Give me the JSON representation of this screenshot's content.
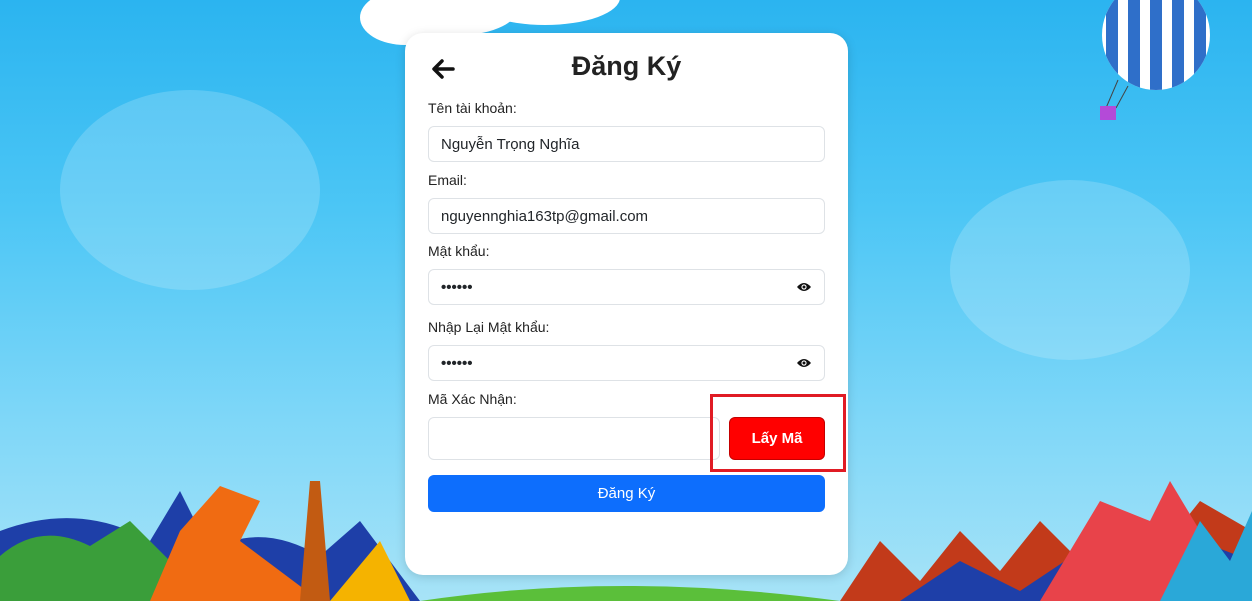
{
  "form": {
    "title": "Đăng Ký",
    "username_label": "Tên tài khoản:",
    "username_value": "Nguyễn Trọng Nghĩa",
    "email_label": "Email:",
    "email_value": "nguyennghia163tp@gmail.com",
    "password_label": "Mật khẩu:",
    "password_value": "••••••",
    "confirm_label": "Nhập Lại Mật khẩu:",
    "confirm_value": "••••••",
    "code_label": "Mã Xác Nhận:",
    "code_value": "",
    "get_code_label": "Lấy Mã",
    "submit_label": "Đăng Ký"
  },
  "icons": {
    "back": "arrow-left-icon",
    "show_password": "eye-icon"
  },
  "colors": {
    "get_code_button": "#ff0000",
    "submit_button": "#0d6efd",
    "highlight_box": "#e01b24"
  }
}
